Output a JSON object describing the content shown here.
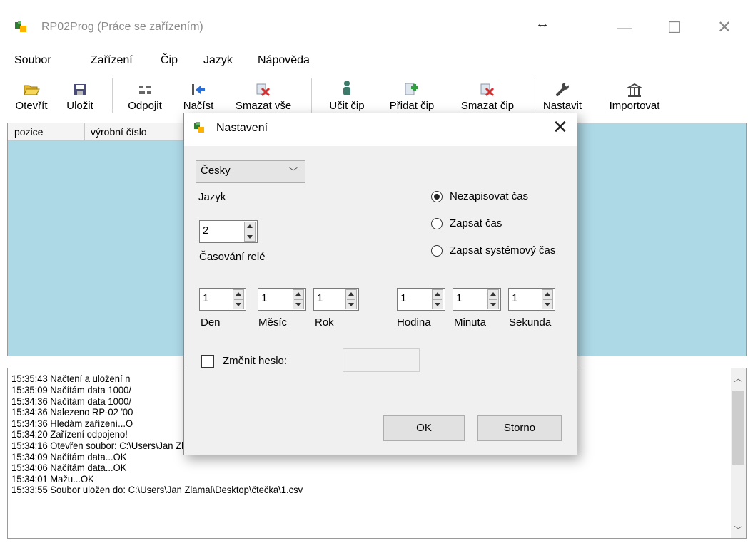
{
  "window": {
    "title": "RP02Prog (Práce se zařízením)",
    "icons": [
      "app-icon",
      "resize-icon",
      "minimize-icon",
      "maximize-icon",
      "close-icon"
    ]
  },
  "menu": {
    "items": [
      "Soubor",
      "Zařízení",
      "Čip",
      "Jazyk",
      "Nápověda"
    ]
  },
  "toolbar": {
    "buttons": [
      {
        "label": "Otevřít",
        "icon": "folder-open-icon"
      },
      {
        "label": "Uložit",
        "icon": "save-icon"
      },
      {
        "label": "Odpojit",
        "icon": "disconnect-icon"
      },
      {
        "label": "Načíst",
        "icon": "load-arrow-icon"
      },
      {
        "label": "Smazat vše",
        "icon": "delete-all-icon"
      },
      {
        "label": "Učit čip",
        "icon": "learn-chip-icon"
      },
      {
        "label": "Přidat čip",
        "icon": "add-chip-icon"
      },
      {
        "label": "Smazat čip",
        "icon": "delete-chip-icon"
      },
      {
        "label": "Nastavit",
        "icon": "wrench-icon"
      },
      {
        "label": "Importovat",
        "icon": "import-icon"
      }
    ]
  },
  "grid": {
    "columns": [
      "pozice",
      "výrobní číslo"
    ]
  },
  "log": {
    "lines": [
      "15:35:43  Načtení a uložení n",
      "15:35:09  Načítám data 1000/",
      "15:34:36  Načítám data 1000/",
      "15:34:36  Nalezeno RP-02 '00",
      "15:34:36  Hledám zařízení...O",
      "15:34:20  Zařízení odpojeno!",
      "15:34:16  Otevřen soubor: C:\\Users\\Jan Zlamal\\Desktop\\čtečka\\1.csv",
      "15:34:09  Načítám data...OK",
      "15:34:06  Načítám data...OK",
      "15:34:01  Mažu...OK",
      "15:33:55  Soubor uložen do: C:\\Users\\Jan Zlamal\\Desktop\\čtečka\\1.csv"
    ]
  },
  "dialog": {
    "title": "Nastavení",
    "language": {
      "selected": "Česky",
      "label": "Jazyk"
    },
    "relay": {
      "value": "2",
      "label": "Časování relé"
    },
    "time_mode": {
      "options": [
        "Nezapisovat čas",
        "Zapsat čas",
        "Zapsat systémový čas"
      ],
      "selected_index": 0
    },
    "date_time": [
      {
        "value": "1",
        "label": "Den"
      },
      {
        "value": "1",
        "label": "Měsíc"
      },
      {
        "value": "1",
        "label": "Rok"
      },
      {
        "value": "1",
        "label": "Hodina"
      },
      {
        "value": "1",
        "label": "Minuta"
      },
      {
        "value": "1",
        "label": "Sekunda"
      }
    ],
    "password": {
      "label": "Změnit heslo:",
      "checked": false,
      "value": ""
    },
    "ok_label": "OK",
    "cancel_label": "Storno"
  }
}
